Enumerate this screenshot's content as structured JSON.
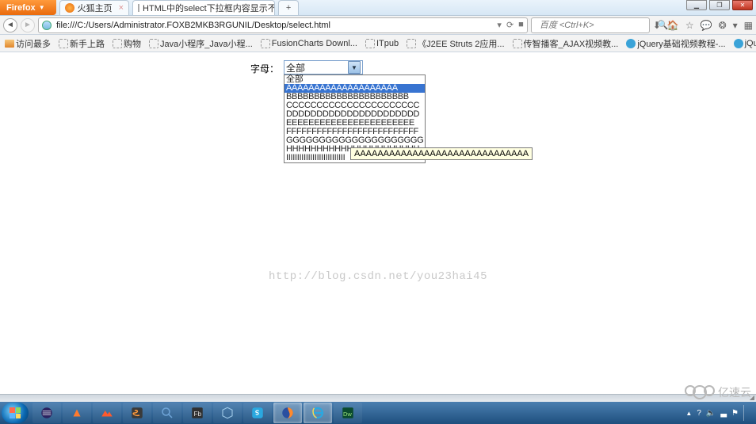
{
  "window_controls": {
    "min": "▁",
    "max": "❐",
    "close": "✕"
  },
  "firefox_button": "Firefox",
  "tabs": [
    {
      "title": "火狐主页",
      "icon": "firefox"
    },
    {
      "title": "HTML中的select下拉框内容显示不...",
      "icon": "page"
    }
  ],
  "new_tab": "+",
  "nav": {
    "back": "◄",
    "forward": "►"
  },
  "url": "file:///C:/Users/Administrator.FOXB2MKB3RGUNIL/Desktop/select.html",
  "url_right": {
    "dropdown": "▾",
    "reload": "⟳",
    "stop": "■"
  },
  "searchbox": {
    "placeholder": "百度 <Ctrl+K>",
    "go": "🔍"
  },
  "toolbar": {
    "download": "⬇",
    "home": "🏠",
    "bookmark": "☆",
    "chat": "💬",
    "feed": "❂",
    "menu": "▾",
    "grid": "▦"
  },
  "bookmarks": {
    "label": "访问最多",
    "items": [
      "新手上路",
      "购物",
      "Java小程序_Java小程...",
      "FusionCharts Downl...",
      "ITpub",
      "《J2EE Struts 2应用...",
      "传智播客_AJAX视频教...",
      "jQuery基础视频教程-...",
      "jQuery_ The Write L..."
    ],
    "more": "»"
  },
  "page": {
    "label": "字母：",
    "selected": "全部",
    "options": [
      "全部",
      "AAAAAAAAAAAAAAAAAAAA",
      "BBBBBBBBBBBBBBBBBBBBBB",
      "CCCCCCCCCCCCCCCCCCCCCC",
      "DDDDDDDDDDDDDDDDDDDDDD",
      "EEEEEEEEEEEEEEEEEEEEEEE",
      "FFFFFFFFFFFFFFFFFFFFFFFFFF",
      "GGGGGGGGGGGGGGGGGGGGG",
      "HHHHHHHHHHHHHHHHHHHHHH",
      "IIIIIIIIIIIIIIIIIIIIIIIIIII"
    ],
    "highlight_index": 1,
    "tooltip": "AAAAAAAAAAAAAAAAAAAAAAAAAAAAAA"
  },
  "watermark": "http://blog.csdn.net/you23hai45",
  "corner_brand": "亿速云",
  "tray": {
    "up": "▲",
    "help": "?",
    "vol": "🔈",
    "net": "▃",
    "flag": "⚑"
  }
}
